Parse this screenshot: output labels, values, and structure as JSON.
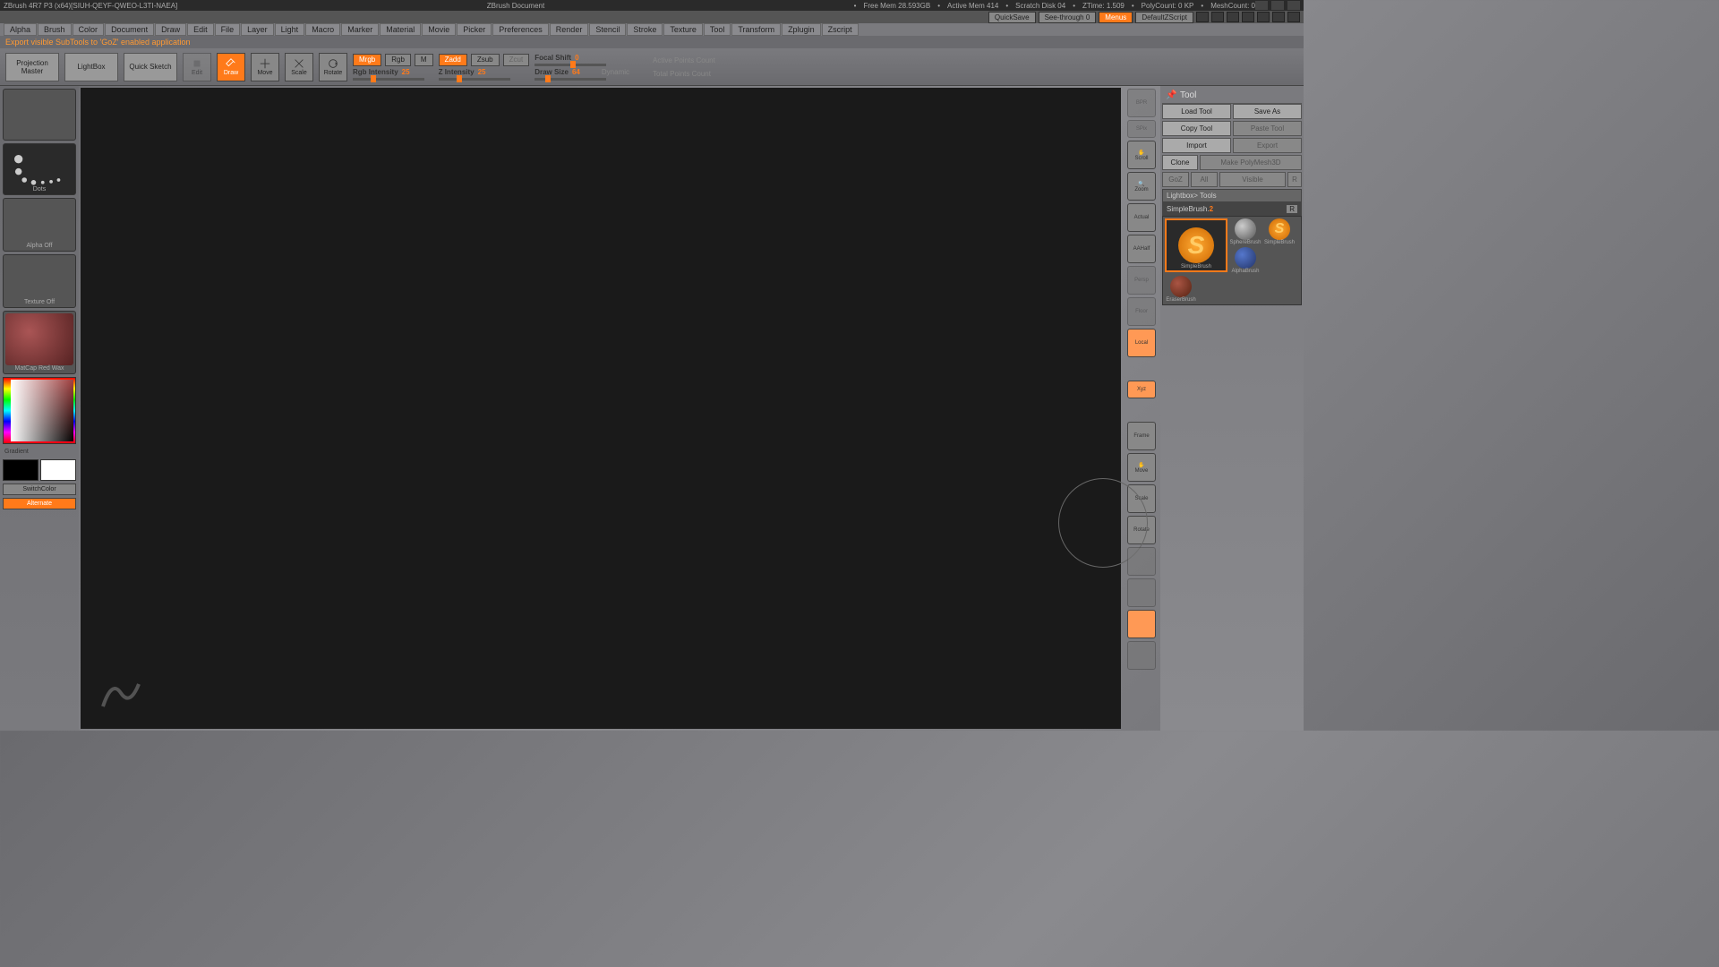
{
  "title": {
    "app": "ZBrush 4R7 P3 (x64)[SIUH-QEYF-QWEO-L3TI-NAEA]",
    "doc": "ZBrush Document",
    "stats": {
      "freemem": "Free Mem 28.593GB",
      "activemem": "Active Mem 414",
      "scratch": "Scratch Disk 04",
      "ztime": "ZTime: 1.509",
      "polycount": "PolyCount: 0 KP",
      "meshcount": "MeshCount: 0"
    }
  },
  "topright": {
    "quicksave": "QuickSave",
    "seethrough": "See-through",
    "seethrough_val": "0",
    "menus": "Menus",
    "script": "DefaultZScript"
  },
  "menus": [
    "Alpha",
    "Brush",
    "Color",
    "Document",
    "Draw",
    "Edit",
    "File",
    "Layer",
    "Light",
    "Macro",
    "Marker",
    "Material",
    "Movie",
    "Picker",
    "Preferences",
    "Render",
    "Stencil",
    "Stroke",
    "Texture",
    "Tool",
    "Transform",
    "Zplugin",
    "Zscript"
  ],
  "status": "Export visible SubTools to 'GoZ' enabled application",
  "toolbar": {
    "projection": "Projection Master",
    "lightbox": "LightBox",
    "quicksketch": "Quick Sketch",
    "edit": "Edit",
    "draw": "Draw",
    "move": "Move",
    "scale": "Scale",
    "rotate": "Rotate",
    "mrgb": "Mrgb",
    "rgb": "Rgb",
    "m": "M",
    "rgb_intensity": "Rgb Intensity",
    "rgb_intensity_val": "25",
    "zadd": "Zadd",
    "zsub": "Zsub",
    "zcut": "Zcut",
    "z_intensity": "Z Intensity",
    "z_intensity_val": "25",
    "focal_shift": "Focal Shift",
    "focal_shift_val": "0",
    "draw_size": "Draw Size",
    "draw_size_val": "64",
    "dynamic": "Dynamic",
    "active_pts": "Active Points Count",
    "total_pts": "Total Points Count"
  },
  "left": {
    "stroke": "Dots",
    "alpha": "Alpha Off",
    "texture": "Texture Off",
    "material": "MatCap Red Wax",
    "gradient": "Gradient",
    "switchcolor": "SwitchColor",
    "alternate": "Alternate"
  },
  "rightside": {
    "bpr": "BPR",
    "spix": "SPix",
    "scroll": "Scroll",
    "zoom": "Zoom",
    "actual": "Actual",
    "aahalf": "AAHalf",
    "persp": "Persp",
    "floor": "Floor",
    "local": "Local",
    "frame": "Frame",
    "move": "Move",
    "scale": "Scale",
    "rotate": "Rotate"
  },
  "tool": {
    "header": "Tool",
    "load": "Load Tool",
    "save": "Save As",
    "copy": "Copy Tool",
    "paste": "Paste Tool",
    "import": "Import",
    "export": "Export",
    "clone": "Clone",
    "makepm": "Make PolyMesh3D",
    "goz": "GoZ",
    "all": "All",
    "visible": "Visible",
    "r": "R",
    "lightbox_tools": "Lightbox> Tools",
    "current": "SimpleBrush.",
    "current_idx": "2",
    "thumbs": {
      "simple": "SimpleBrush",
      "sphere": "SphereBrush",
      "alpha": "AlphaBrush",
      "simple2": "SimpleBrush",
      "eraser": "EraserBrush"
    }
  }
}
